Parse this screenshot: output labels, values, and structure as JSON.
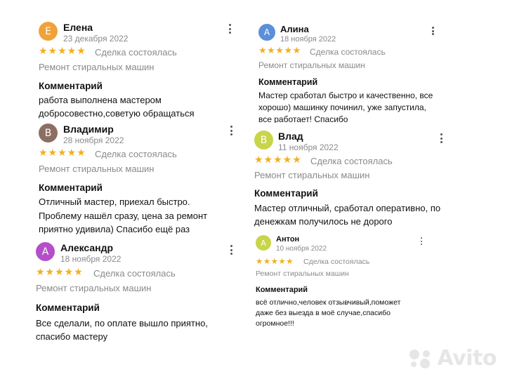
{
  "reviews": [
    {
      "initial": "Е",
      "avatar_color": "#f0a23a",
      "name": "Елена",
      "date": "23 декабря 2022",
      "stars": "★★★★★",
      "deal": "Сделка состоялась",
      "service": "Ремонт стиральных машин",
      "comment_title": "Комментарий",
      "comment_lines": [
        "работа выполнена  мастером",
        "добросовестно,советую обращаться"
      ]
    },
    {
      "initial": "А",
      "avatar_color": "#5b8fd9",
      "name": "Алина",
      "date": "18 ноября 2022",
      "stars": "★★★★★",
      "deal": "Сделка состоялась",
      "service": "Ремонт стиральных машин",
      "comment_title": "Комментарий",
      "comment_lines": [
        "Мастер сработал быстро и качественно, все",
        "хорошо) машинку починил, уже запустила,",
        "все работает! Спасибо"
      ]
    },
    {
      "initial": "В",
      "avatar_color": "#8d6e63",
      "name": "Владимир",
      "date": "28 ноября 2022",
      "stars": "★★★★★",
      "deal": "Сделка состоялась",
      "service": "Ремонт стиральных машин",
      "comment_title": "Комментарий",
      "comment_lines": [
        "Отличный мастер, приехал быстро.",
        "Проблему нашёл сразу, цена за ремонт",
        "приятно удивила) Спасибо ещё раз"
      ]
    },
    {
      "initial": "В",
      "avatar_color": "#c8d44a",
      "name": "Влад",
      "date": "11 ноября 2022",
      "stars": "★★★★★",
      "deal": "Сделка состоялась",
      "service": "Ремонт стиральных машин",
      "comment_title": "Комментарий",
      "comment_lines": [
        "Мастер отличный, сработал оперативно, по",
        "денежкам получилось не дорого"
      ]
    },
    {
      "initial": "А",
      "avatar_color": "#b44fc9",
      "name": "Александр",
      "date": "18 ноября 2022",
      "stars": "★★★★★",
      "deal": "Сделка состоялась",
      "service": "Ремонт стиральных машин",
      "comment_title": "Комментарий",
      "comment_lines": [
        "Все сделали, по оплате вышло приятно,",
        "спасибо мастеру"
      ]
    },
    {
      "initial": "А",
      "avatar_color": "#c8d44a",
      "name": "Антон",
      "date": "10 ноября 2022",
      "stars": "★★★★★",
      "deal": "Сделка состоялась",
      "service": "Ремонт стиральных машин",
      "comment_title": "Комментарий",
      "comment_lines": [
        "всё отлично,человек отзывчивый,поможет",
        "даже без выезда в моё случае,спасибо",
        "огромное!!!"
      ]
    }
  ],
  "watermark": {
    "text": "Avito",
    "icon": "avito-logo-icon"
  }
}
